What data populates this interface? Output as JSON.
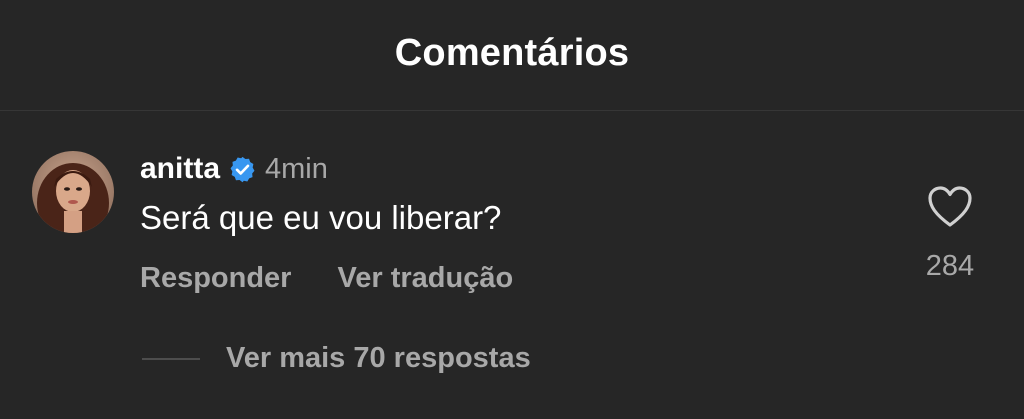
{
  "header": {
    "title": "Comentários"
  },
  "comment": {
    "avatar_icon": "avatar-photo",
    "username": "anitta",
    "verified_icon": "verified-badge-icon",
    "verified_color": "#3897f0",
    "timestamp": "4min",
    "text": "Será que eu vou liberar?",
    "actions": {
      "reply_label": "Responder",
      "translate_label": "Ver tradução"
    },
    "like": {
      "icon": "heart-icon",
      "count": "284"
    },
    "more_replies_label": "Ver mais 70 respostas"
  },
  "colors": {
    "background": "#262626",
    "primary_text": "#ffffff",
    "secondary_text": "#a8a8a8"
  }
}
